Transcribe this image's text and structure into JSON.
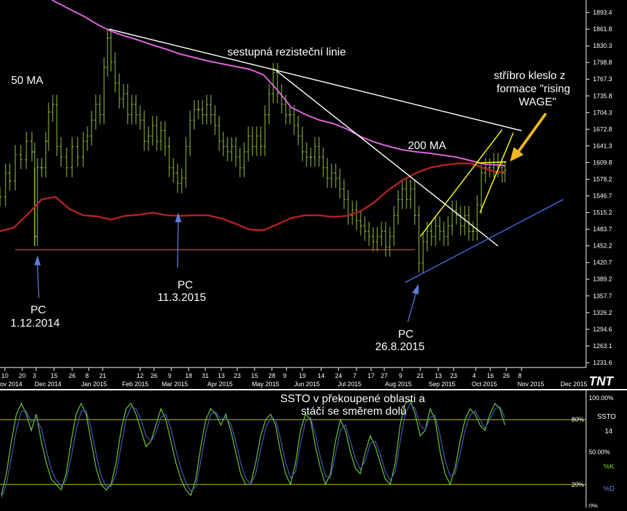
{
  "chart_data": [
    {
      "type": "ohlc",
      "title": "",
      "ylim": [
        1215,
        1910
      ],
      "y_ticks": [
        "1893.4",
        "1861.8",
        "1830.3",
        "1798.8",
        "1767.3",
        "1735.8",
        "1704.3",
        "1672.8",
        "1641.3",
        "1609.8",
        "1578.2",
        "1546.7",
        "1515.2",
        "1483.7",
        "1452.2",
        "1420.7",
        "1389.2",
        "1357.7",
        "1326.2",
        "1294.6",
        "1263.1",
        "1231.6"
      ],
      "x_day_ticks": [
        "10",
        "20",
        "3",
        "15",
        "26",
        "8",
        "21",
        "12",
        "26",
        "9",
        "18",
        "31",
        "13",
        "23",
        "15",
        "28",
        "9",
        "19",
        "14",
        "24",
        "7",
        "17",
        "27",
        "9",
        "21",
        "13",
        "23",
        "4",
        "16",
        "26",
        "8"
      ],
      "x_month_ticks": [
        "ov 2014",
        "Dec 2014",
        "Jan 2015",
        "Feb 2015",
        "Mar 2015",
        "Apr 2015",
        "May 2015",
        "Jun 2015",
        "Jul 2015",
        "Aug 2015",
        "Sep 2015",
        "Oct 2015",
        "Nov 2015",
        "Dec 2015"
      ],
      "series": [
        {
          "name": "50 MA",
          "color": "#b22222"
        },
        {
          "name": "200 MA",
          "color": "#e066e0"
        }
      ],
      "price_series": {
        "color": "#9ccc44",
        "points": [
          [
            0,
            1545
          ],
          [
            8,
            1590
          ],
          [
            14,
            1575
          ],
          [
            22,
            1625
          ],
          [
            30,
            1615
          ],
          [
            38,
            1650
          ],
          [
            46,
            1630
          ],
          [
            50,
            1470
          ],
          [
            54,
            1600
          ],
          [
            60,
            1600
          ],
          [
            66,
            1650
          ],
          [
            70,
            1705
          ],
          [
            76,
            1720
          ],
          [
            82,
            1640
          ],
          [
            88,
            1620
          ],
          [
            96,
            1600
          ],
          [
            104,
            1640
          ],
          [
            112,
            1620
          ],
          [
            120,
            1650
          ],
          [
            126,
            1660
          ],
          [
            132,
            1690
          ],
          [
            138,
            1720
          ],
          [
            144,
            1700
          ],
          [
            150,
            1790
          ],
          [
            155,
            1845
          ],
          [
            160,
            1800
          ],
          [
            166,
            1760
          ],
          [
            172,
            1730
          ],
          [
            178,
            1740
          ],
          [
            184,
            1700
          ],
          [
            190,
            1720
          ],
          [
            196,
            1700
          ],
          [
            202,
            1690
          ],
          [
            208,
            1650
          ],
          [
            214,
            1660
          ],
          [
            220,
            1680
          ],
          [
            226,
            1650
          ],
          [
            232,
            1670
          ],
          [
            238,
            1640
          ],
          [
            244,
            1600
          ],
          [
            250,
            1590
          ],
          [
            256,
            1570
          ],
          [
            262,
            1580
          ],
          [
            268,
            1640
          ],
          [
            274,
            1690
          ],
          [
            280,
            1710
          ],
          [
            286,
            1710
          ],
          [
            292,
            1700
          ],
          [
            298,
            1720
          ],
          [
            304,
            1700
          ],
          [
            310,
            1680
          ],
          [
            316,
            1650
          ],
          [
            322,
            1640
          ],
          [
            328,
            1630
          ],
          [
            334,
            1640
          ],
          [
            340,
            1620
          ],
          [
            346,
            1600
          ],
          [
            352,
            1630
          ],
          [
            358,
            1660
          ],
          [
            364,
            1640
          ],
          [
            370,
            1660
          ],
          [
            376,
            1640
          ],
          [
            382,
            1700
          ],
          [
            388,
            1740
          ],
          [
            394,
            1780
          ],
          [
            400,
            1740
          ],
          [
            406,
            1720
          ],
          [
            412,
            1700
          ],
          [
            418,
            1700
          ],
          [
            424,
            1680
          ],
          [
            430,
            1660
          ],
          [
            436,
            1630
          ],
          [
            442,
            1620
          ],
          [
            448,
            1620
          ],
          [
            454,
            1640
          ],
          [
            460,
            1620
          ],
          [
            466,
            1600
          ],
          [
            472,
            1580
          ],
          [
            478,
            1590
          ],
          [
            484,
            1580
          ],
          [
            490,
            1560
          ],
          [
            496,
            1540
          ],
          [
            502,
            1510
          ],
          [
            508,
            1520
          ],
          [
            514,
            1500
          ],
          [
            520,
            1490
          ],
          [
            526,
            1480
          ],
          [
            532,
            1470
          ],
          [
            538,
            1460
          ],
          [
            544,
            1470
          ],
          [
            550,
            1480
          ],
          [
            556,
            1450
          ],
          [
            562,
            1470
          ],
          [
            568,
            1510
          ],
          [
            574,
            1540
          ],
          [
            580,
            1560
          ],
          [
            586,
            1540
          ],
          [
            592,
            1560
          ],
          [
            598,
            1510
          ],
          [
            604,
            1420
          ],
          [
            610,
            1460
          ],
          [
            616,
            1480
          ],
          [
            622,
            1470
          ],
          [
            628,
            1490
          ],
          [
            634,
            1480
          ],
          [
            640,
            1470
          ],
          [
            646,
            1490
          ],
          [
            652,
            1520
          ],
          [
            658,
            1510
          ],
          [
            664,
            1490
          ],
          [
            670,
            1510
          ],
          [
            676,
            1480
          ],
          [
            682,
            1480
          ],
          [
            688,
            1530
          ],
          [
            694,
            1590
          ],
          [
            700,
            1600
          ],
          [
            706,
            1600
          ],
          [
            712,
            1610
          ],
          [
            718,
            1600
          ],
          [
            724,
            1590
          ],
          [
            728,
            1595
          ]
        ]
      },
      "ma50_points": [
        [
          0,
          1480
        ],
        [
          20,
          1487
        ],
        [
          40,
          1512
        ],
        [
          60,
          1540
        ],
        [
          80,
          1545
        ],
        [
          100,
          1522
        ],
        [
          120,
          1510
        ],
        [
          140,
          1508
        ],
        [
          160,
          1502
        ],
        [
          180,
          1509
        ],
        [
          200,
          1511
        ],
        [
          220,
          1515
        ],
        [
          240,
          1510
        ],
        [
          260,
          1509
        ],
        [
          280,
          1510
        ],
        [
          300,
          1510
        ],
        [
          320,
          1504
        ],
        [
          340,
          1494
        ],
        [
          360,
          1483
        ],
        [
          380,
          1482
        ],
        [
          400,
          1493
        ],
        [
          420,
          1505
        ],
        [
          440,
          1510
        ],
        [
          460,
          1510
        ],
        [
          480,
          1507
        ],
        [
          500,
          1509
        ],
        [
          520,
          1518
        ],
        [
          540,
          1535
        ],
        [
          560,
          1558
        ],
        [
          580,
          1576
        ],
        [
          600,
          1590
        ],
        [
          620,
          1600
        ],
        [
          640,
          1605
        ],
        [
          660,
          1608
        ],
        [
          680,
          1608
        ],
        [
          700,
          1598
        ],
        [
          715,
          1592
        ],
        [
          728,
          1592
        ]
      ],
      "ma200_points": [
        [
          75,
          0
        ],
        [
          100,
          13
        ],
        [
          120,
          23
        ],
        [
          140,
          35
        ],
        [
          160,
          45
        ],
        [
          180,
          52
        ],
        [
          200,
          58
        ],
        [
          220,
          65
        ],
        [
          240,
          71
        ],
        [
          260,
          78
        ],
        [
          280,
          83
        ],
        [
          300,
          88
        ],
        [
          320,
          92
        ],
        [
          340,
          96
        ],
        [
          360,
          100
        ],
        [
          380,
          108
        ],
        [
          400,
          130
        ],
        [
          420,
          155
        ],
        [
          440,
          165
        ],
        [
          460,
          173
        ],
        [
          480,
          178
        ],
        [
          500,
          186
        ],
        [
          520,
          197
        ],
        [
          540,
          205
        ],
        [
          560,
          211
        ],
        [
          580,
          216
        ],
        [
          600,
          219
        ],
        [
          620,
          221
        ],
        [
          640,
          224
        ],
        [
          660,
          227
        ],
        [
          680,
          232
        ],
        [
          700,
          237
        ],
        [
          720,
          238
        ],
        [
          728,
          239
        ]
      ],
      "lines": [
        {
          "name": "resistance",
          "color": "#ffffff",
          "from": [
            157,
            1862
          ],
          "to": [
            752,
            1670
          ]
        },
        {
          "name": "steep-down",
          "color": "#ffffff",
          "from": [
            395,
            1787
          ],
          "to": [
            718,
            1452
          ]
        },
        {
          "name": "support-horizontal",
          "color": "#e07060",
          "from": [
            22,
            1445
          ],
          "to": [
            598,
            1445
          ]
        },
        {
          "name": "wedge-lower",
          "color": "#ffff00",
          "from": [
            606,
            1470
          ],
          "to": [
            724,
            1672
          ]
        },
        {
          "name": "wedge-lower-2",
          "color": "#ffff00",
          "from": [
            692,
            1515
          ],
          "to": [
            740,
            1666
          ]
        },
        {
          "name": "box-right",
          "color": "#ffff00",
          "from": [
            688,
            1609
          ],
          "to": [
            730,
            1611
          ]
        },
        {
          "name": "rising-support",
          "color": "#4169e1",
          "from": [
            584,
            1383
          ],
          "to": [
            812,
            1540
          ]
        }
      ],
      "annotations": {
        "resistance_label": "sestupná rezisteční linie",
        "ma50_label": "50 MA",
        "ma200_label": "200 MA",
        "silver_line1": "stříbro kleslo z",
        "silver_line2": "formace \"rising",
        "silver_line3": "WAGE\"",
        "pc1_label": "PC",
        "pc1_date": "1.12.2014",
        "pc2_label": "PC",
        "pc2_date": "11.3.2015",
        "pc3_label": "PC",
        "pc3_date": "26.8.2015",
        "logo": "TNT"
      }
    },
    {
      "type": "line",
      "title": "SSTO",
      "ylim": [
        0,
        100
      ],
      "y_ticks": [
        "100.00%",
        "80%",
        "50.00%",
        "20%",
        "0%"
      ],
      "side_labels": {
        "name": "SSTO",
        "period": "14",
        "k": "%K",
        "d": "%D"
      },
      "annotation_line1": "SSTO v překoupené oblasti a",
      "annotation_line2": "stáčí se směrem dolů",
      "reference_lines": [
        80,
        20
      ],
      "series": [
        {
          "name": "%K",
          "color": "#6ccf3c",
          "values": [
            10,
            30,
            60,
            85,
            95,
            85,
            70,
            85,
            60,
            40,
            25,
            20,
            15,
            30,
            60,
            85,
            95,
            85,
            60,
            35,
            20,
            15,
            20,
            40,
            70,
            90,
            95,
            85,
            70,
            55,
            60,
            75,
            90,
            80,
            60,
            40,
            25,
            15,
            10,
            25,
            55,
            80,
            90,
            85,
            75,
            85,
            70,
            50,
            30,
            20,
            20,
            40,
            65,
            80,
            85,
            75,
            50,
            30,
            20,
            40,
            70,
            85,
            80,
            55,
            35,
            20,
            30,
            60,
            80,
            70,
            50,
            35,
            30,
            50,
            65,
            55,
            40,
            25,
            20,
            40,
            75,
            95,
            98,
            85,
            65,
            70,
            90,
            80,
            50,
            30,
            20,
            35,
            60,
            80,
            90,
            85,
            75,
            70,
            85,
            95,
            90,
            75
          ]
        },
        {
          "name": "%D",
          "color": "#4b59b8",
          "values": [
            8,
            20,
            45,
            70,
            88,
            88,
            78,
            80,
            72,
            52,
            34,
            24,
            18,
            24,
            45,
            70,
            88,
            88,
            72,
            48,
            28,
            18,
            18,
            30,
            55,
            80,
            92,
            90,
            80,
            65,
            60,
            68,
            82,
            85,
            72,
            52,
            35,
            22,
            14,
            18,
            42,
            68,
            85,
            87,
            80,
            82,
            76,
            60,
            40,
            26,
            20,
            30,
            52,
            72,
            82,
            80,
            62,
            40,
            26,
            32,
            58,
            78,
            82,
            66,
            45,
            28,
            26,
            48,
            70,
            75,
            60,
            44,
            34,
            42,
            58,
            60,
            48,
            32,
            24,
            32,
            60,
            85,
            95,
            90,
            75,
            70,
            82,
            84,
            65,
            42,
            28,
            30,
            48,
            70,
            84,
            88,
            80,
            72,
            80,
            90,
            92,
            82
          ]
        }
      ]
    }
  ]
}
